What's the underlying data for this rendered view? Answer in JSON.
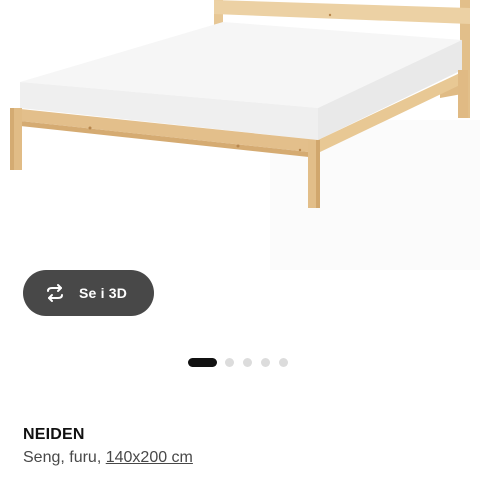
{
  "product_image": {
    "alt": "Bed"
  },
  "view_3d_button": {
    "label": "Se i 3D",
    "icon": "rotate-3d-icon"
  },
  "carousel": {
    "dot_count": 5,
    "active_index": 0
  },
  "product": {
    "name": "NEIDEN",
    "description": "Seng, furu, ",
    "size_link": "140x200 cm"
  }
}
